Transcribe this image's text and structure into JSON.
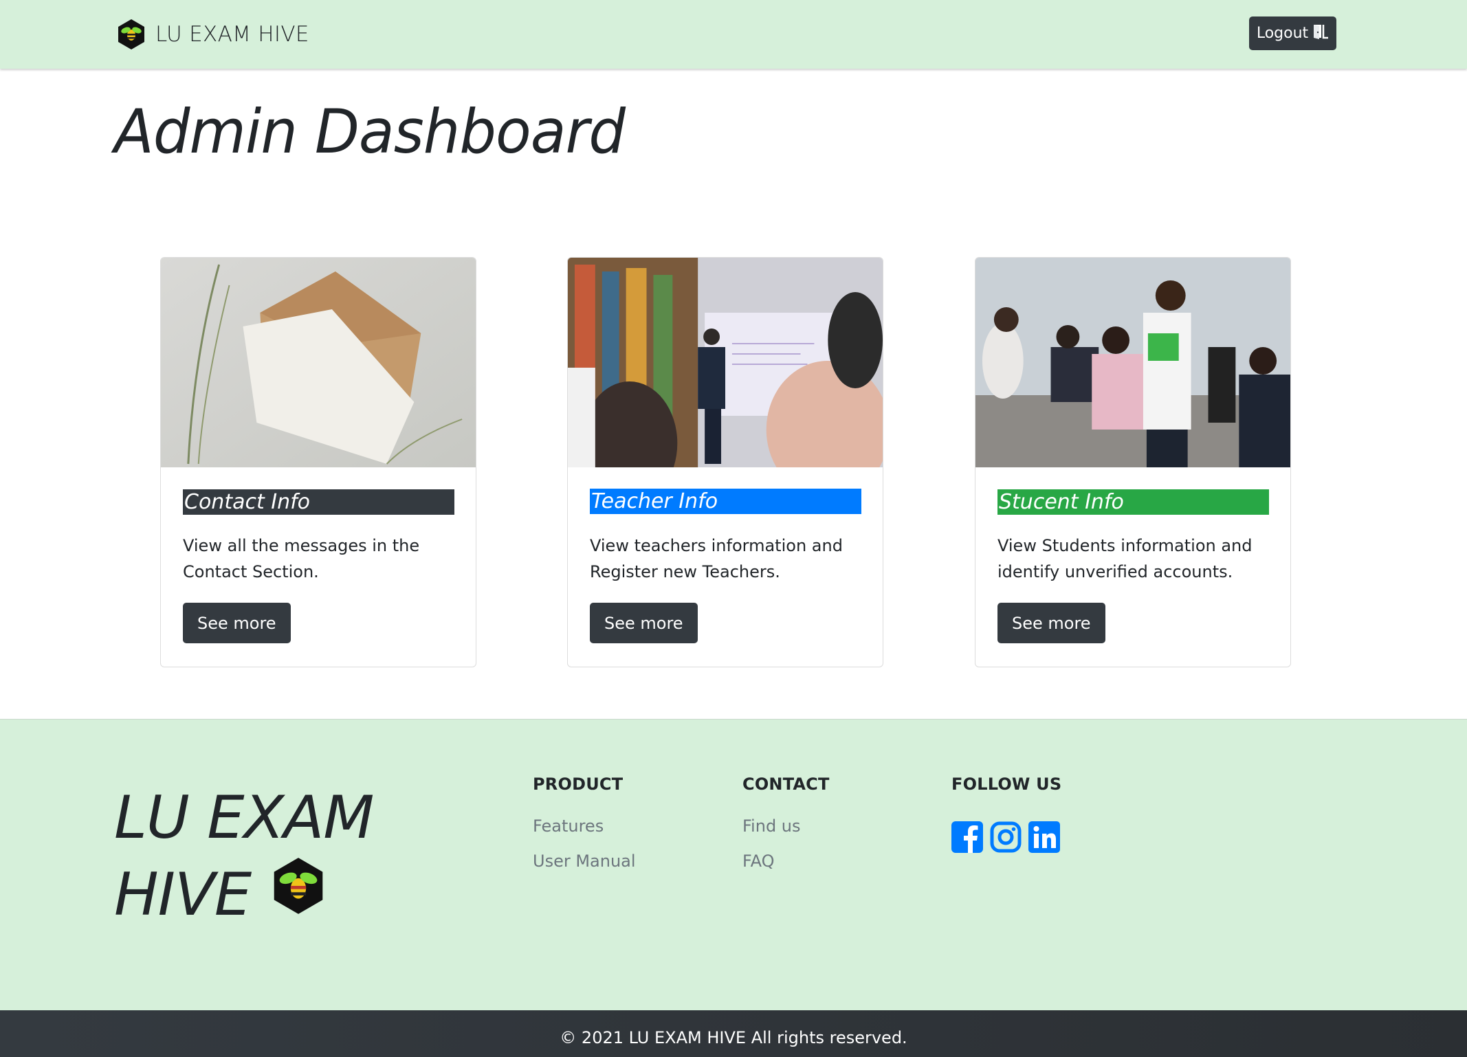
{
  "header": {
    "brand": "LU EXAM HIVE",
    "logout_label": "Logout"
  },
  "page": {
    "title": "Admin Dashboard"
  },
  "cards": [
    {
      "title": "Contact Info",
      "title_bg": "#343a40",
      "text": "View all the messages in the Contact Section.",
      "button": "See more"
    },
    {
      "title": "Teacher Info",
      "title_bg": "#007bff",
      "text": "View teachers information and Register new Teachers.",
      "button": "See more"
    },
    {
      "title": "Stucent Info",
      "title_bg": "#28a745",
      "text": "View Students information and identify unverified accounts.",
      "button": "See more"
    }
  ],
  "footer": {
    "logo_line1": "LU EXAM",
    "logo_line2": "HIVE",
    "product": {
      "heading": "PRODUCT",
      "links": [
        "Features",
        "User Manual"
      ]
    },
    "contact": {
      "heading": "CONTACT",
      "links": [
        "Find us",
        "FAQ"
      ]
    },
    "follow": {
      "heading": "FOLLOW US",
      "icons": [
        "facebook-icon",
        "instagram-icon",
        "linkedin-icon"
      ],
      "icon_color": "#007bff"
    },
    "copyright": "© 2021 LU EXAM HIVE All rights reserved."
  },
  "colors": {
    "header_bg": "#d6f0da",
    "dark": "#343a40",
    "primary": "#007bff",
    "success": "#28a745"
  }
}
